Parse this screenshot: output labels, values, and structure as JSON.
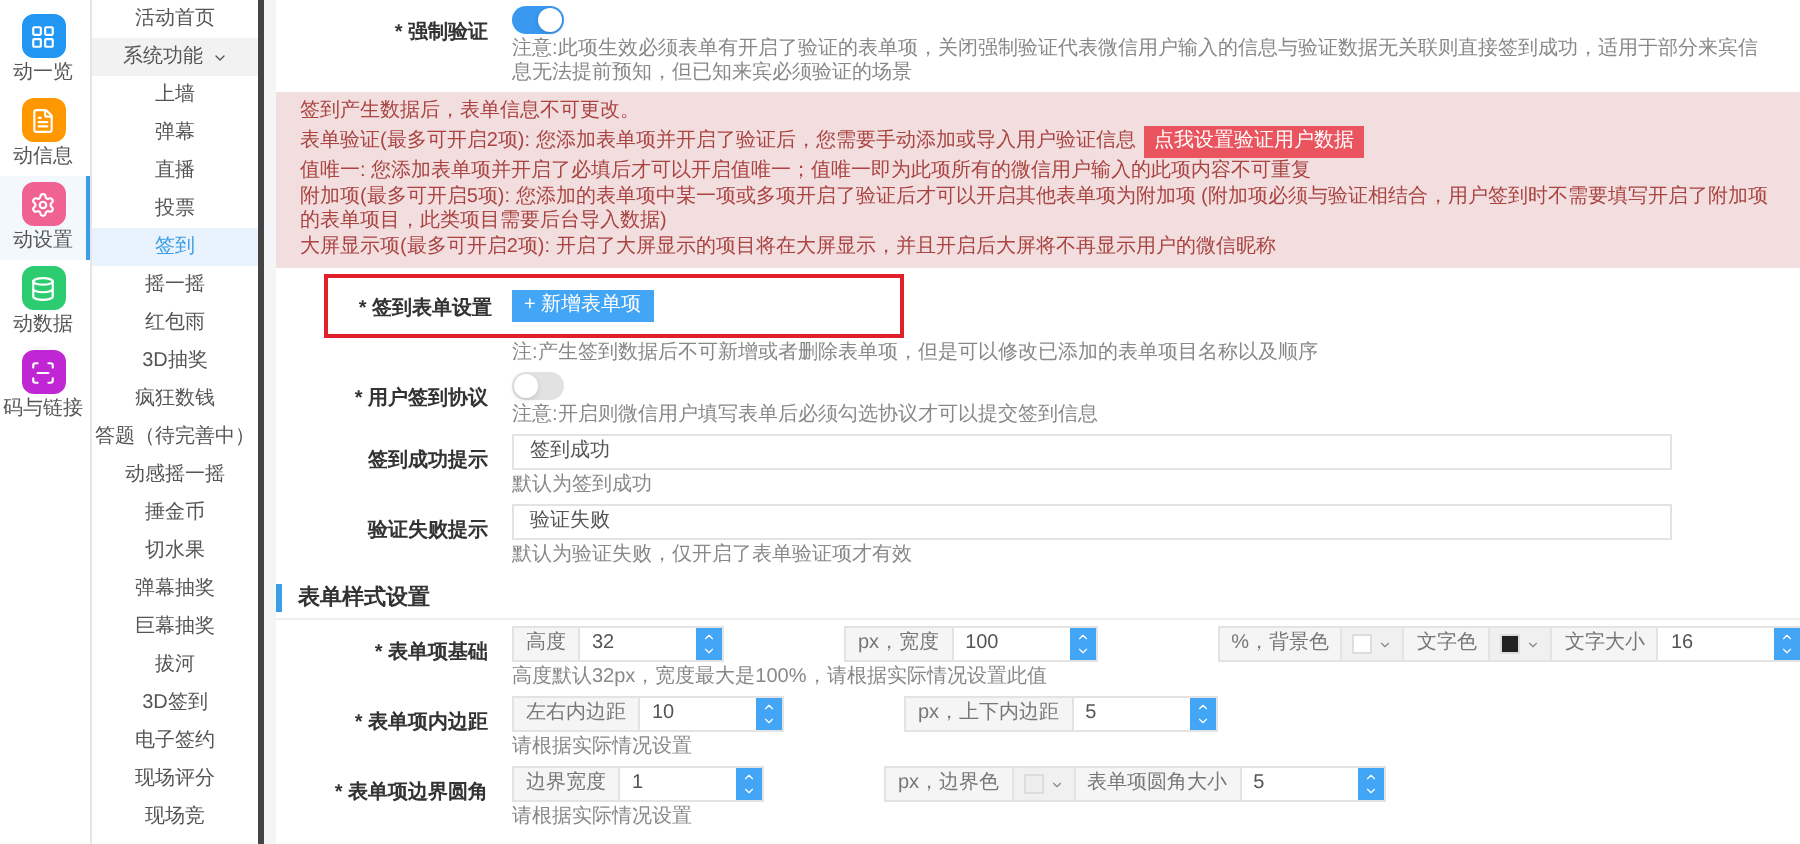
{
  "icon_rail": [
    {
      "kind": "grid",
      "label": "动一览",
      "color": "#2196f3",
      "selected": false
    },
    {
      "kind": "document",
      "label": "动信息",
      "color": "#ff9800",
      "selected": false
    },
    {
      "kind": "gear",
      "label": "动设置",
      "color": "#f06292",
      "selected": true
    },
    {
      "kind": "database",
      "label": "动数据",
      "color": "#2ecc71",
      "selected": false
    },
    {
      "kind": "scan",
      "label": "码与链接",
      "color": "#c026d3",
      "selected": false
    }
  ],
  "sub_nav": [
    {
      "label": "活动首页",
      "selected": false
    },
    {
      "label": "系统功能",
      "selected": false,
      "expanded": true,
      "children": [
        {
          "label": "上墙",
          "selected": false
        },
        {
          "label": "弹幕",
          "selected": false
        },
        {
          "label": "直播",
          "selected": false
        },
        {
          "label": "投票",
          "selected": false
        },
        {
          "label": "签到",
          "selected": true
        },
        {
          "label": "摇一摇",
          "selected": false
        },
        {
          "label": "红包雨",
          "selected": false
        },
        {
          "label": "3D抽奖",
          "selected": false
        },
        {
          "label": "疯狂数钱",
          "selected": false
        },
        {
          "label": "答题（待完善中）",
          "selected": false
        },
        {
          "label": "动感摇一摇",
          "selected": false
        },
        {
          "label": "捶金币",
          "selected": false
        },
        {
          "label": "切水果",
          "selected": false
        },
        {
          "label": "弹幕抽奖",
          "selected": false
        },
        {
          "label": "巨幕抽奖",
          "selected": false
        },
        {
          "label": "拔河",
          "selected": false
        },
        {
          "label": "3D签到",
          "selected": false
        },
        {
          "label": "电子签约",
          "selected": false
        },
        {
          "label": "现场评分",
          "selected": false
        },
        {
          "label": "现场竞",
          "selected": false
        }
      ]
    }
  ],
  "rows": [
    {
      "kind": "switch",
      "label": "* 强制验证",
      "on": true,
      "note": "注意:此项生效必须表单有开启了验证的表单项，关闭强制验证代表微信用户输入的信息与验证数据无关联则直接签到成功，适用于部分来宾信息无法提前预知，但已知来宾必须验证的场景"
    },
    {
      "kind": "alert",
      "lines": [
        {
          "text": "签到产生数据后，表单信息不可更改。"
        },
        {
          "text": "表单验证(最多可开启2项): 您添加表单项并开启了验证后，您需要手动添加或导入用户验证信息",
          "button": "点我设置验证用户数据"
        },
        {
          "text": "值唯一: 您添加表单项并开启了必填后才可以开启值唯一；值唯一即为此项所有的微信用户输入的此项内容不可重复"
        },
        {
          "text": "附加项(最多可开启5项): 您添加的表单项中某一项或多项开启了验证后才可以开启其他表单项为附加项 (附加项必须与验证相结合，用户签到时不需要填写开启了附加项的表单项目，此类项目需要后台导入数据)"
        },
        {
          "text": "大屏显示项(最多可开启2项): 开启了大屏显示的项目将在大屏显示，并且开启后大屏将不再显示用户的微信昵称"
        }
      ]
    },
    {
      "kind": "button",
      "label": "* 签到表单设置",
      "button": "+ 新增表单项",
      "highlighted": true,
      "note": "注:产生签到数据后不可新增或者删除表单项，但是可以修改已添加的表单项目名称以及顺序"
    },
    {
      "kind": "switch",
      "label": "* 用户签到协议",
      "on": false,
      "note": "注意:开启则微信用户填写表单后必须勾选协议才可以提交签到信息"
    },
    {
      "kind": "text",
      "label": "签到成功提示",
      "value": "签到成功",
      "note": "默认为签到成功"
    },
    {
      "kind": "text",
      "label": "验证失败提示",
      "value": "验证失败",
      "note": "默认为验证失败，仅开启了表单验证项才有效"
    }
  ],
  "style_section": {
    "title": "表单样式设置",
    "rows": [
      {
        "label": "* 表单项基础",
        "note": "高度默认32px，宽度最大是100%，请根据实际情况设置此值",
        "groups": [
          [
            {
              "kind": "addon",
              "text": "高度"
            },
            {
              "kind": "number",
              "value": "32"
            }
          ],
          [
            {
              "kind": "addon",
              "text": "px，宽度"
            },
            {
              "kind": "number",
              "value": "100"
            }
          ],
          [
            {
              "kind": "addon",
              "text": "%，背景色"
            },
            {
              "kind": "color",
              "color": "#ffffff"
            },
            {
              "kind": "addon",
              "text": "文字色"
            },
            {
              "kind": "color",
              "color": "#222222"
            },
            {
              "kind": "addon",
              "text": "文字大小"
            },
            {
              "kind": "number",
              "value": "16"
            }
          ]
        ]
      },
      {
        "label": "* 表单项内边距",
        "note": "请根据实际情况设置",
        "groups": [
          [
            {
              "kind": "addon",
              "text": "左右内边距"
            },
            {
              "kind": "number",
              "value": "10"
            }
          ],
          [
            {
              "kind": "addon",
              "text": "px，上下内边距"
            },
            {
              "kind": "number",
              "value": "5"
            }
          ]
        ]
      },
      {
        "label": "* 表单项边界圆角",
        "note": "请根据实际情况设置",
        "groups": [
          [
            {
              "kind": "addon",
              "text": "边界宽度"
            },
            {
              "kind": "number",
              "value": "1"
            }
          ],
          [
            {
              "kind": "addon",
              "text": "px，边界色"
            },
            {
              "kind": "color",
              "color": "#eeeeee"
            },
            {
              "kind": "addon",
              "text": "表单项圆角大小"
            },
            {
              "kind": "number",
              "value": "5"
            }
          ]
        ]
      }
    ]
  }
}
